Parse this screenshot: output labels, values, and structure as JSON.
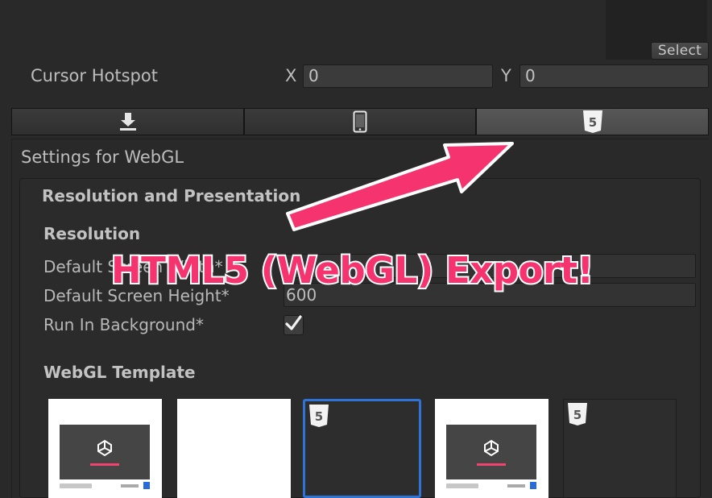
{
  "cursor": {
    "label": "Cursor Hotspot",
    "x_label": "X",
    "x_value": "0",
    "y_label": "Y",
    "y_value": "0",
    "select_label": "Select"
  },
  "tabs": [
    {
      "icon": "download-icon"
    },
    {
      "icon": "mobile-phone-icon"
    },
    {
      "icon": "html5-icon",
      "active": true
    }
  ],
  "settings": {
    "title": "Settings for WebGL",
    "section": "Resolution and Presentation",
    "resolution_header": "Resolution",
    "width_label": "Default Screen Width*",
    "width_value": "",
    "height_label": "Default Screen Height*",
    "height_value": "600",
    "run_bg_label": "Run In Background*",
    "run_bg_checked": true,
    "template_header": "WebGL Template"
  },
  "templates": [
    {
      "kind": "default",
      "selected": false
    },
    {
      "kind": "minimal",
      "selected": false
    },
    {
      "kind": "html5",
      "selected": true
    },
    {
      "kind": "default",
      "selected": false
    },
    {
      "kind": "html5",
      "selected": false
    }
  ],
  "annotation": {
    "text": "HTML5 (WebGL) Export!",
    "color": "#f5336f"
  },
  "colors": {
    "selected_border": "#2e74d8",
    "accent_pink": "#f0446d"
  }
}
